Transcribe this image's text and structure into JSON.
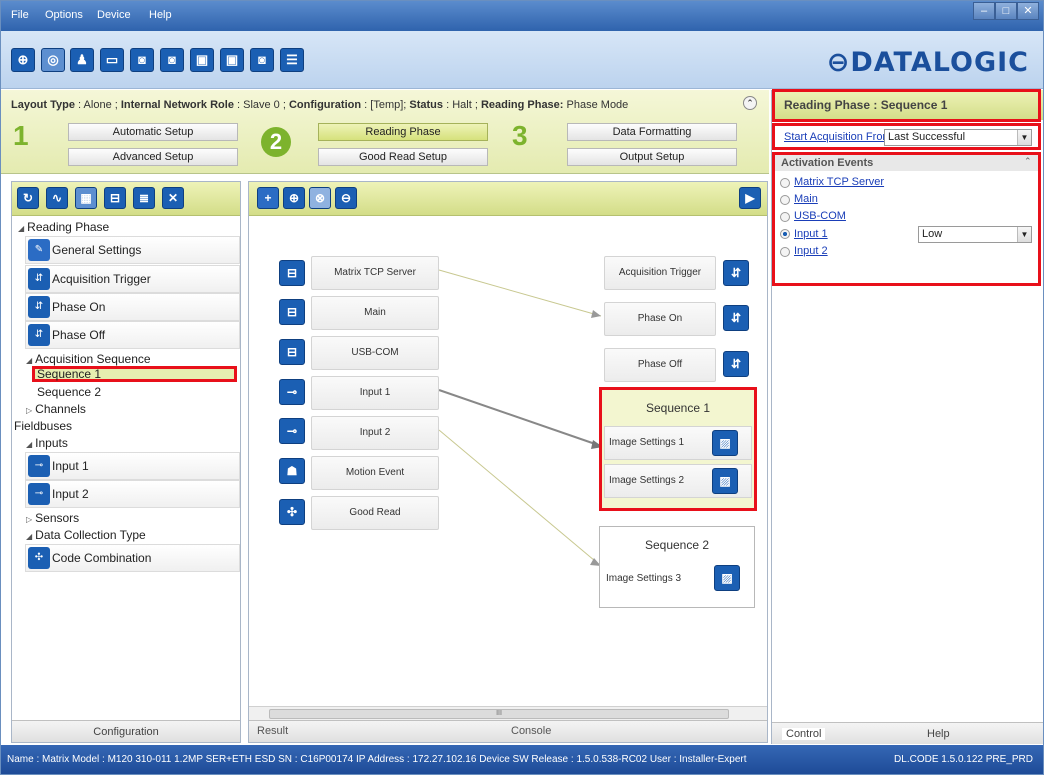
{
  "menu": [
    "File",
    "Options",
    "Device",
    "Help"
  ],
  "window_buttons": [
    "–",
    "□",
    "✕"
  ],
  "brand": "⊖DATALOGIC",
  "status_line": {
    "layout_label": "Layout Type",
    "layout_value": "Alone",
    "role_label": "Internal Network Role",
    "role_value": "Slave 0",
    "config_label": "Configuration",
    "config_value": "[Temp]",
    "status_label": "Status",
    "status_value": "Halt",
    "phase_label": "Reading Phase:",
    "phase_value": "Phase Mode"
  },
  "steps": [
    {
      "num": "1",
      "top": "Automatic Setup",
      "bottom": "Advanced Setup"
    },
    {
      "num": "2",
      "top": "Reading Phase",
      "bottom": "Good Read Setup"
    },
    {
      "num": "3",
      "top": "Data Formatting",
      "bottom": "Output Setup"
    }
  ],
  "tree": {
    "reading_phase": "Reading Phase",
    "general_settings": "General Settings",
    "acquisition_trigger": "Acquisition Trigger",
    "phase_on": "Phase On",
    "phase_off": "Phase Off",
    "acquisition_sequence": "Acquisition Sequence",
    "sequence1": "Sequence  1",
    "sequence2": "Sequence  2",
    "channels": "Channels",
    "fieldbuses": "Fieldbuses",
    "inputs": "Inputs",
    "input1": "Input 1",
    "input2": "Input 2",
    "sensors": "Sensors",
    "data_collection": "Data Collection Type",
    "code_combination": "Code Combination"
  },
  "left_tab": "Configuration",
  "diagram": {
    "sources": [
      "Matrix TCP Server",
      "Main",
      "USB-COM",
      "Input 1",
      "Input 2",
      "Motion Event",
      "Good Read"
    ],
    "targets": [
      "Acquisition Trigger",
      "Phase On",
      "Phase Off"
    ],
    "seq1_title": "Sequence  1",
    "seq1_items": [
      "Image Settings  1",
      "Image Settings  2"
    ],
    "seq2_title": "Sequence  2",
    "seq2_items": [
      "Image Settings  3"
    ]
  },
  "scroll_mark": "III",
  "center_tabs": {
    "result": "Result",
    "console": "Console"
  },
  "right": {
    "title": "Reading Phase :  Sequence 1",
    "start_label": "Start Acquisition From",
    "start_value": "Last Successful",
    "events_header": "Activation Events",
    "events": [
      "Matrix TCP Server",
      "Main",
      "USB-COM",
      "Input 1",
      "Input 2"
    ],
    "input1_level": "Low",
    "tab_control": "Control",
    "tab_help": "Help"
  },
  "statusbar": {
    "left": "Name : Matrix   Model : M120 310-011 1.2MP SER+ETH ESD   SN : C16P00174   IP Address :  172.27.102.16   Device SW Release : 1.5.0.538-RC02   User : Installer-Expert",
    "right": "DL.CODE 1.5.0.122 PRE_PRD"
  }
}
